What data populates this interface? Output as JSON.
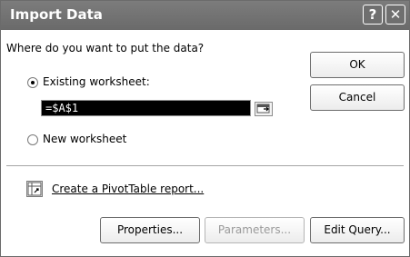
{
  "dialog": {
    "title": "Import Data",
    "help_glyph": "?",
    "close_glyph": "✕"
  },
  "prompt": "Where do you want to put the data?",
  "options": {
    "existing_label": "Existing worksheet:",
    "existing_selected": true,
    "new_label": "New worksheet",
    "new_selected": false
  },
  "reference": {
    "value": "=$A$1"
  },
  "pivot": {
    "label": "Create a PivotTable report..."
  },
  "buttons": {
    "ok": "OK",
    "cancel": "Cancel",
    "properties": "Properties...",
    "parameters": "Parameters...",
    "edit_query": "Edit Query..."
  },
  "icons": {
    "help": "help-icon",
    "close": "close-icon",
    "collapse": "collapse-dialog-icon",
    "pivot": "pivot-table-icon"
  }
}
